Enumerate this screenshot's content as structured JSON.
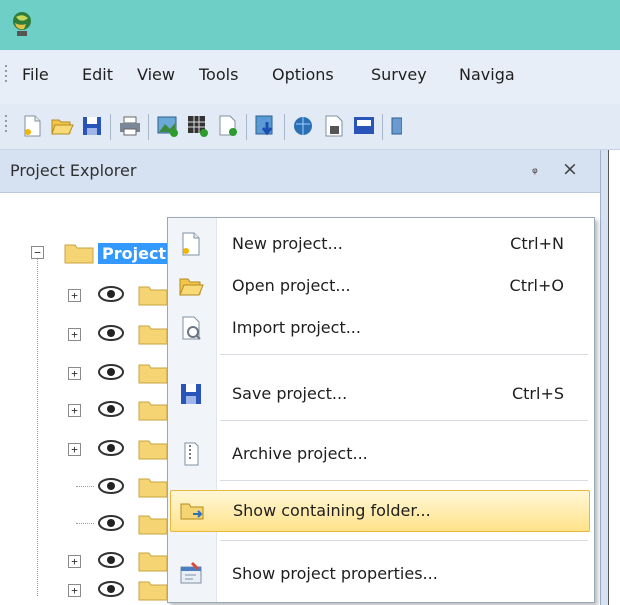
{
  "menubar": {
    "items": [
      "File",
      "Edit",
      "View",
      "Tools",
      "Options",
      "Survey",
      "Naviga"
    ]
  },
  "panel": {
    "title": "Project Explorer",
    "pin_glyph": "ᵩ",
    "close_glyph": "×"
  },
  "tree": {
    "root_label": "Project",
    "expanders": [
      "−",
      "+",
      "+",
      "+",
      "+",
      "+",
      "+",
      "+",
      "+"
    ]
  },
  "context_menu": {
    "items": [
      {
        "label": "New project...",
        "shortcut": "Ctrl+N",
        "icon": "new-file-icon"
      },
      {
        "label": "Open project...",
        "shortcut": "Ctrl+O",
        "icon": "open-folder-icon"
      },
      {
        "label": "Import project...",
        "shortcut": "",
        "icon": "import-icon"
      },
      {
        "label": "Save project...",
        "shortcut": "Ctrl+S",
        "icon": "save-icon"
      },
      {
        "label": "Archive project...",
        "shortcut": "",
        "icon": "archive-icon"
      },
      {
        "label": "Show containing folder...",
        "shortcut": "",
        "icon": "folder-arrow-icon"
      },
      {
        "label": "Show project properties...",
        "shortcut": "",
        "icon": "properties-icon"
      }
    ],
    "highlighted_index": 5
  },
  "colors": {
    "titlebar": "#6ecfc6",
    "menubar": "#e8eef7",
    "selection": "#3399ff",
    "highlight": "#ffe28a"
  }
}
